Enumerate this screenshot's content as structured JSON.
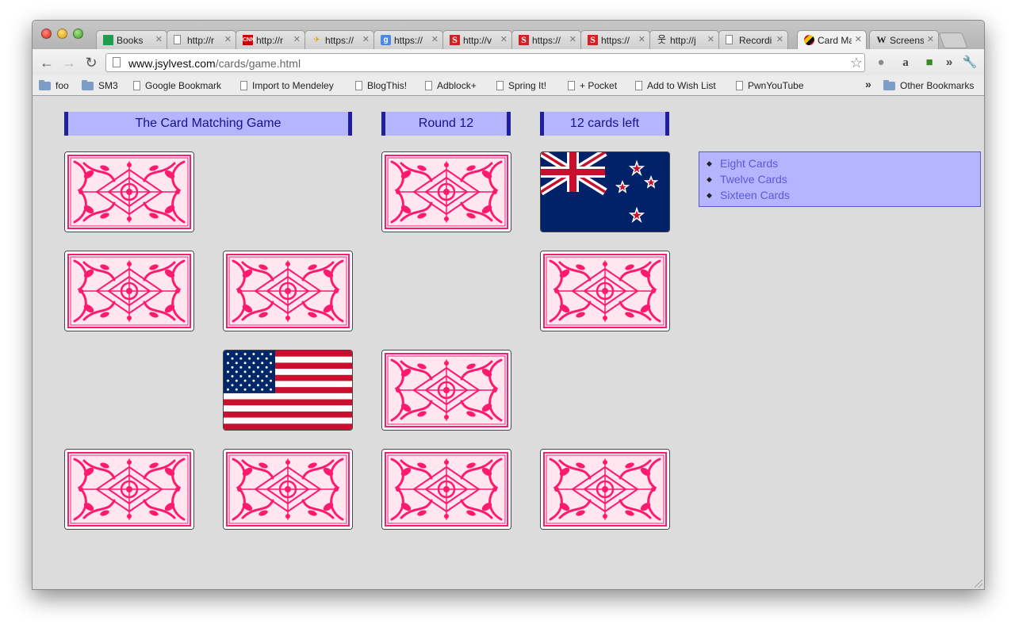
{
  "browser": {
    "tabs": [
      {
        "label": "Books",
        "icon": "sheets-icon",
        "active": false
      },
      {
        "label": "http://r",
        "icon": "page-icon",
        "active": false
      },
      {
        "label": "http://r",
        "icon": "cnn-icon",
        "active": false
      },
      {
        "label": "https://",
        "icon": "bird-icon",
        "active": false
      },
      {
        "label": "https://",
        "icon": "google-icon",
        "active": false
      },
      {
        "label": "http://v",
        "icon": "s-icon",
        "active": false
      },
      {
        "label": "https://",
        "icon": "s-icon",
        "active": false
      },
      {
        "label": "https://",
        "icon": "s-icon",
        "active": false
      },
      {
        "label": "http://j",
        "icon": "person-icon",
        "active": false
      },
      {
        "label": "Recordi",
        "icon": "page-icon",
        "active": false
      },
      {
        "label": "Card Ma",
        "icon": "maryland-flag-icon",
        "active": true
      },
      {
        "label": "Screens",
        "icon": "wikipedia-icon",
        "active": false
      }
    ],
    "address": {
      "domain": "www.jsylvest.com",
      "path": "/cards/game.html"
    },
    "bookmarks": [
      {
        "label": "foo",
        "type": "folder"
      },
      {
        "label": "SM3",
        "type": "folder"
      },
      {
        "label": "Google Bookmark",
        "type": "page"
      },
      {
        "label": "Import to Mendeley",
        "type": "page"
      },
      {
        "label": "BlogThis!",
        "type": "page"
      },
      {
        "label": "Adblock+",
        "type": "page"
      },
      {
        "label": "Spring It!",
        "type": "page"
      },
      {
        "label": "+ Pocket",
        "type": "page"
      },
      {
        "label": "Add to Wish List",
        "type": "page"
      },
      {
        "label": "PwnYouTube",
        "type": "page"
      }
    ],
    "other_bookmarks": "Other Bookmarks",
    "overflow": "»"
  },
  "game": {
    "title": "The Card Matching Game",
    "round": "Round 12",
    "cards_left": "12 cards left",
    "menu": [
      "Eight Cards",
      "Twelve Cards",
      "Sixteen Cards"
    ],
    "colors": {
      "header_bg": "#b4b4ff",
      "header_border": "#1f1fa0",
      "card_pattern": "#ff1a6e",
      "page_bg": "#dcdcdc"
    }
  }
}
